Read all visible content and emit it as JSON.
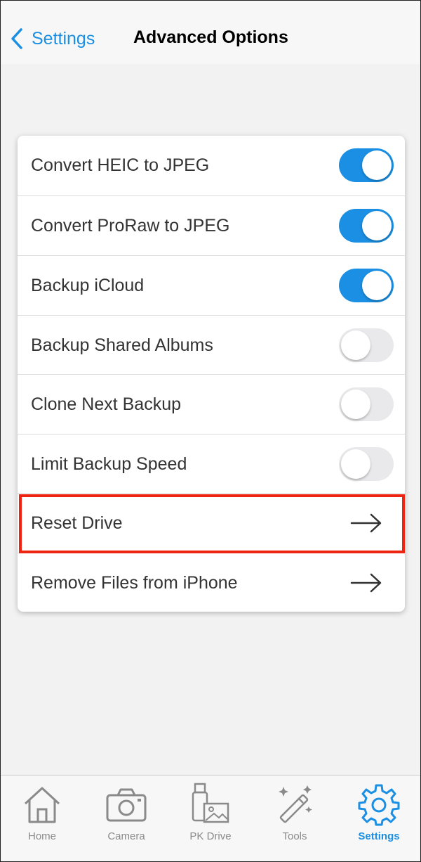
{
  "navbar": {
    "back_label": "Settings",
    "title": "Advanced Options",
    "back_icon": "chevron-left-icon"
  },
  "options": [
    {
      "label": "Convert HEIC to JPEG",
      "type": "toggle",
      "on": true
    },
    {
      "label": "Convert ProRaw to JPEG",
      "type": "toggle",
      "on": true
    },
    {
      "label": "Backup iCloud",
      "type": "toggle",
      "on": true
    },
    {
      "label": "Backup Shared Albums",
      "type": "toggle",
      "on": false
    },
    {
      "label": "Clone Next Backup",
      "type": "toggle",
      "on": false
    },
    {
      "label": "Limit Backup Speed",
      "type": "toggle",
      "on": false
    },
    {
      "label": "Reset Drive",
      "type": "arrow",
      "icon": "arrow-right-icon",
      "highlighted": true
    },
    {
      "label": "Remove Files from iPhone",
      "type": "arrow",
      "icon": "arrow-right-icon"
    }
  ],
  "tabs": [
    {
      "label": "Home",
      "icon": "home-icon",
      "active": false
    },
    {
      "label": "Camera",
      "icon": "camera-icon",
      "active": false
    },
    {
      "label": "PK Drive",
      "icon": "drive-icon",
      "active": false
    },
    {
      "label": "Tools",
      "icon": "magic-wand-icon",
      "active": false
    },
    {
      "label": "Settings",
      "icon": "gear-icon",
      "active": true
    }
  ],
  "colors": {
    "accent": "#1a8fe3",
    "highlight": "#ee2512",
    "toggle_off": "#e9e9eb",
    "inactive_tab": "#8a8a8a"
  }
}
